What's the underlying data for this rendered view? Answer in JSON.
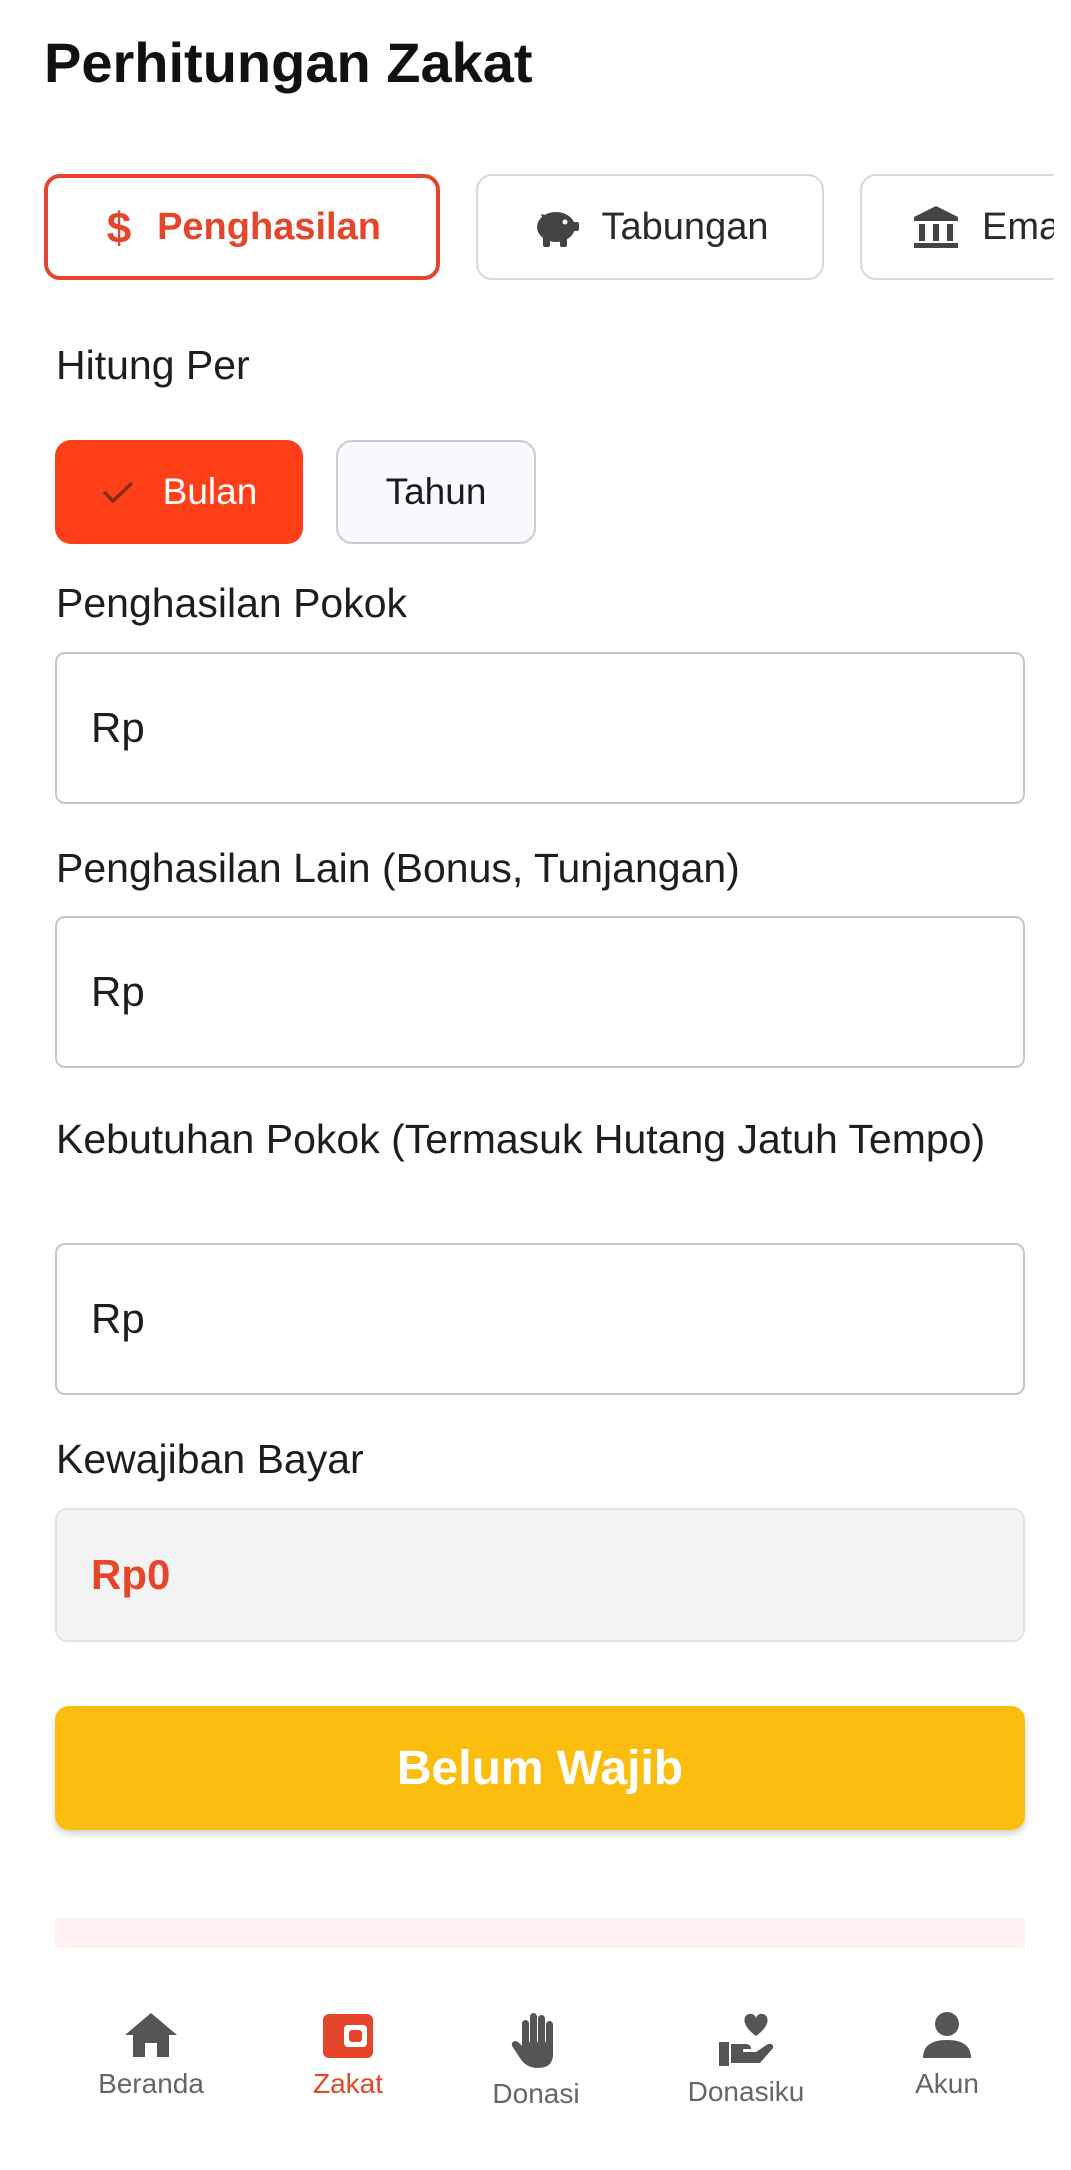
{
  "header": {
    "title": "Perhitungan Zakat"
  },
  "categories": [
    {
      "label": "Penghasilan",
      "icon": "dollar-icon",
      "active": true
    },
    {
      "label": "Tabungan",
      "icon": "piggy-bank-icon",
      "active": false
    },
    {
      "label": "Emas",
      "icon": "bank-icon",
      "active": false
    }
  ],
  "period": {
    "label": "Hitung Per",
    "options": [
      {
        "label": "Bulan",
        "selected": true
      },
      {
        "label": "Tahun",
        "selected": false
      }
    ]
  },
  "fields": [
    {
      "label": "Penghasilan Pokok",
      "prefix": "Rp",
      "value": ""
    },
    {
      "label": "Penghasilan Lain (Bonus, Tunjangan)",
      "prefix": "Rp",
      "value": ""
    },
    {
      "label": "Kebutuhan Pokok (Termasuk Hutang Jatuh Tempo)",
      "prefix": "Rp",
      "value": ""
    }
  ],
  "result": {
    "label": "Kewajiban Bayar",
    "value": "Rp0"
  },
  "submit": {
    "label": "Belum Wajib"
  },
  "nav": [
    {
      "label": "Beranda",
      "icon": "home-icon",
      "active": false
    },
    {
      "label": "Zakat",
      "icon": "wallet-icon",
      "active": true
    },
    {
      "label": "Donasi",
      "icon": "hand-icon",
      "active": false
    },
    {
      "label": "Donasiku",
      "icon": "donation-heart-icon",
      "active": false
    },
    {
      "label": "Akun",
      "icon": "person-icon",
      "active": false
    }
  ],
  "colors": {
    "accent": "#e5452a",
    "selected_chip": "#ff3f17",
    "button": "#fbbd0e",
    "inactive": "#666666"
  }
}
